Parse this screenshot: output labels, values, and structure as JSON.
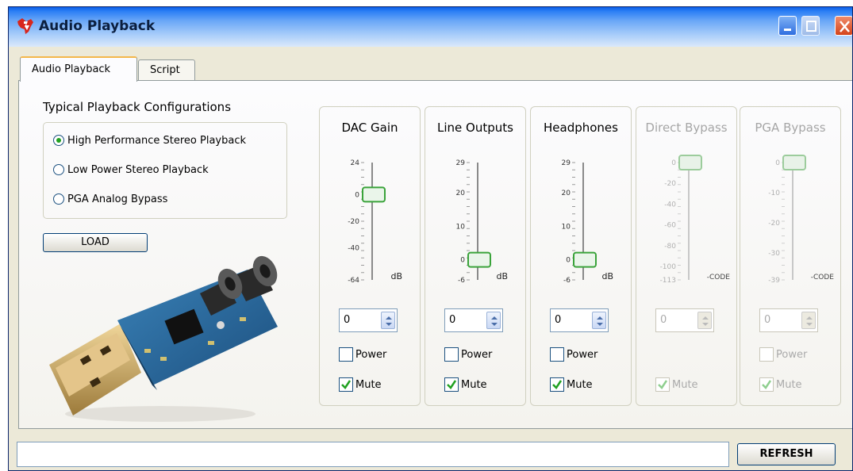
{
  "window": {
    "title": "Audio Playback",
    "icon": "ti-logo-icon",
    "controls": [
      "minimize-icon",
      "maximize-icon",
      "close-icon"
    ]
  },
  "tabs": [
    {
      "label": "Audio Playback",
      "selected": true
    },
    {
      "label": "Script",
      "selected": false
    }
  ],
  "config": {
    "title": "Typical Playback Configurations",
    "options": [
      {
        "label": "High Performance Stereo Playback",
        "selected": true
      },
      {
        "label": "Low Power Stereo Playback",
        "selected": false
      },
      {
        "label": "PGA Analog Bypass",
        "selected": false
      }
    ],
    "load_label": "LOAD"
  },
  "groups": [
    {
      "title": "DAC Gain",
      "enabled": true,
      "ticks": [
        "24",
        "0",
        "-20",
        "-40",
        "-64"
      ],
      "unit": "dB",
      "slider_value": 0,
      "slider_range": [
        -64,
        24
      ],
      "spin_value": "0",
      "power_label": "Power",
      "power_checked": false,
      "mute_label": "Mute",
      "mute_checked": true
    },
    {
      "title": "Line Outputs",
      "enabled": true,
      "ticks": [
        "29",
        "20",
        "10",
        "0",
        "-6"
      ],
      "unit": "dB",
      "slider_value": 0,
      "slider_range": [
        -6,
        29
      ],
      "spin_value": "0",
      "power_label": "Power",
      "power_checked": false,
      "mute_label": "Mute",
      "mute_checked": true
    },
    {
      "title": "Headphones",
      "enabled": true,
      "ticks": [
        "29",
        "20",
        "10",
        "0",
        "-6"
      ],
      "unit": "dB",
      "slider_value": 0,
      "slider_range": [
        -6,
        29
      ],
      "spin_value": "0",
      "power_label": "Power",
      "power_checked": false,
      "mute_label": "Mute",
      "mute_checked": true
    },
    {
      "title": "Direct Bypass",
      "enabled": false,
      "ticks": [
        "0",
        "-20",
        "-40",
        "-60",
        "-80",
        "-100",
        "-113"
      ],
      "unit": "-CODE",
      "slider_value": 0,
      "slider_range": [
        -113,
        0
      ],
      "spin_value": "0",
      "mute_label": "Mute",
      "mute_checked": true
    },
    {
      "title": "PGA Bypass",
      "enabled": false,
      "ticks": [
        "0",
        "-10",
        "-20",
        "-30",
        "-39"
      ],
      "unit": "-CODE",
      "slider_value": 0,
      "slider_range": [
        -39,
        0
      ],
      "spin_value": "0",
      "power_label": "Power",
      "power_checked": false,
      "mute_label": "Mute",
      "mute_checked": true
    }
  ],
  "status": {
    "text": ""
  },
  "refresh_label": "REFRESH"
}
